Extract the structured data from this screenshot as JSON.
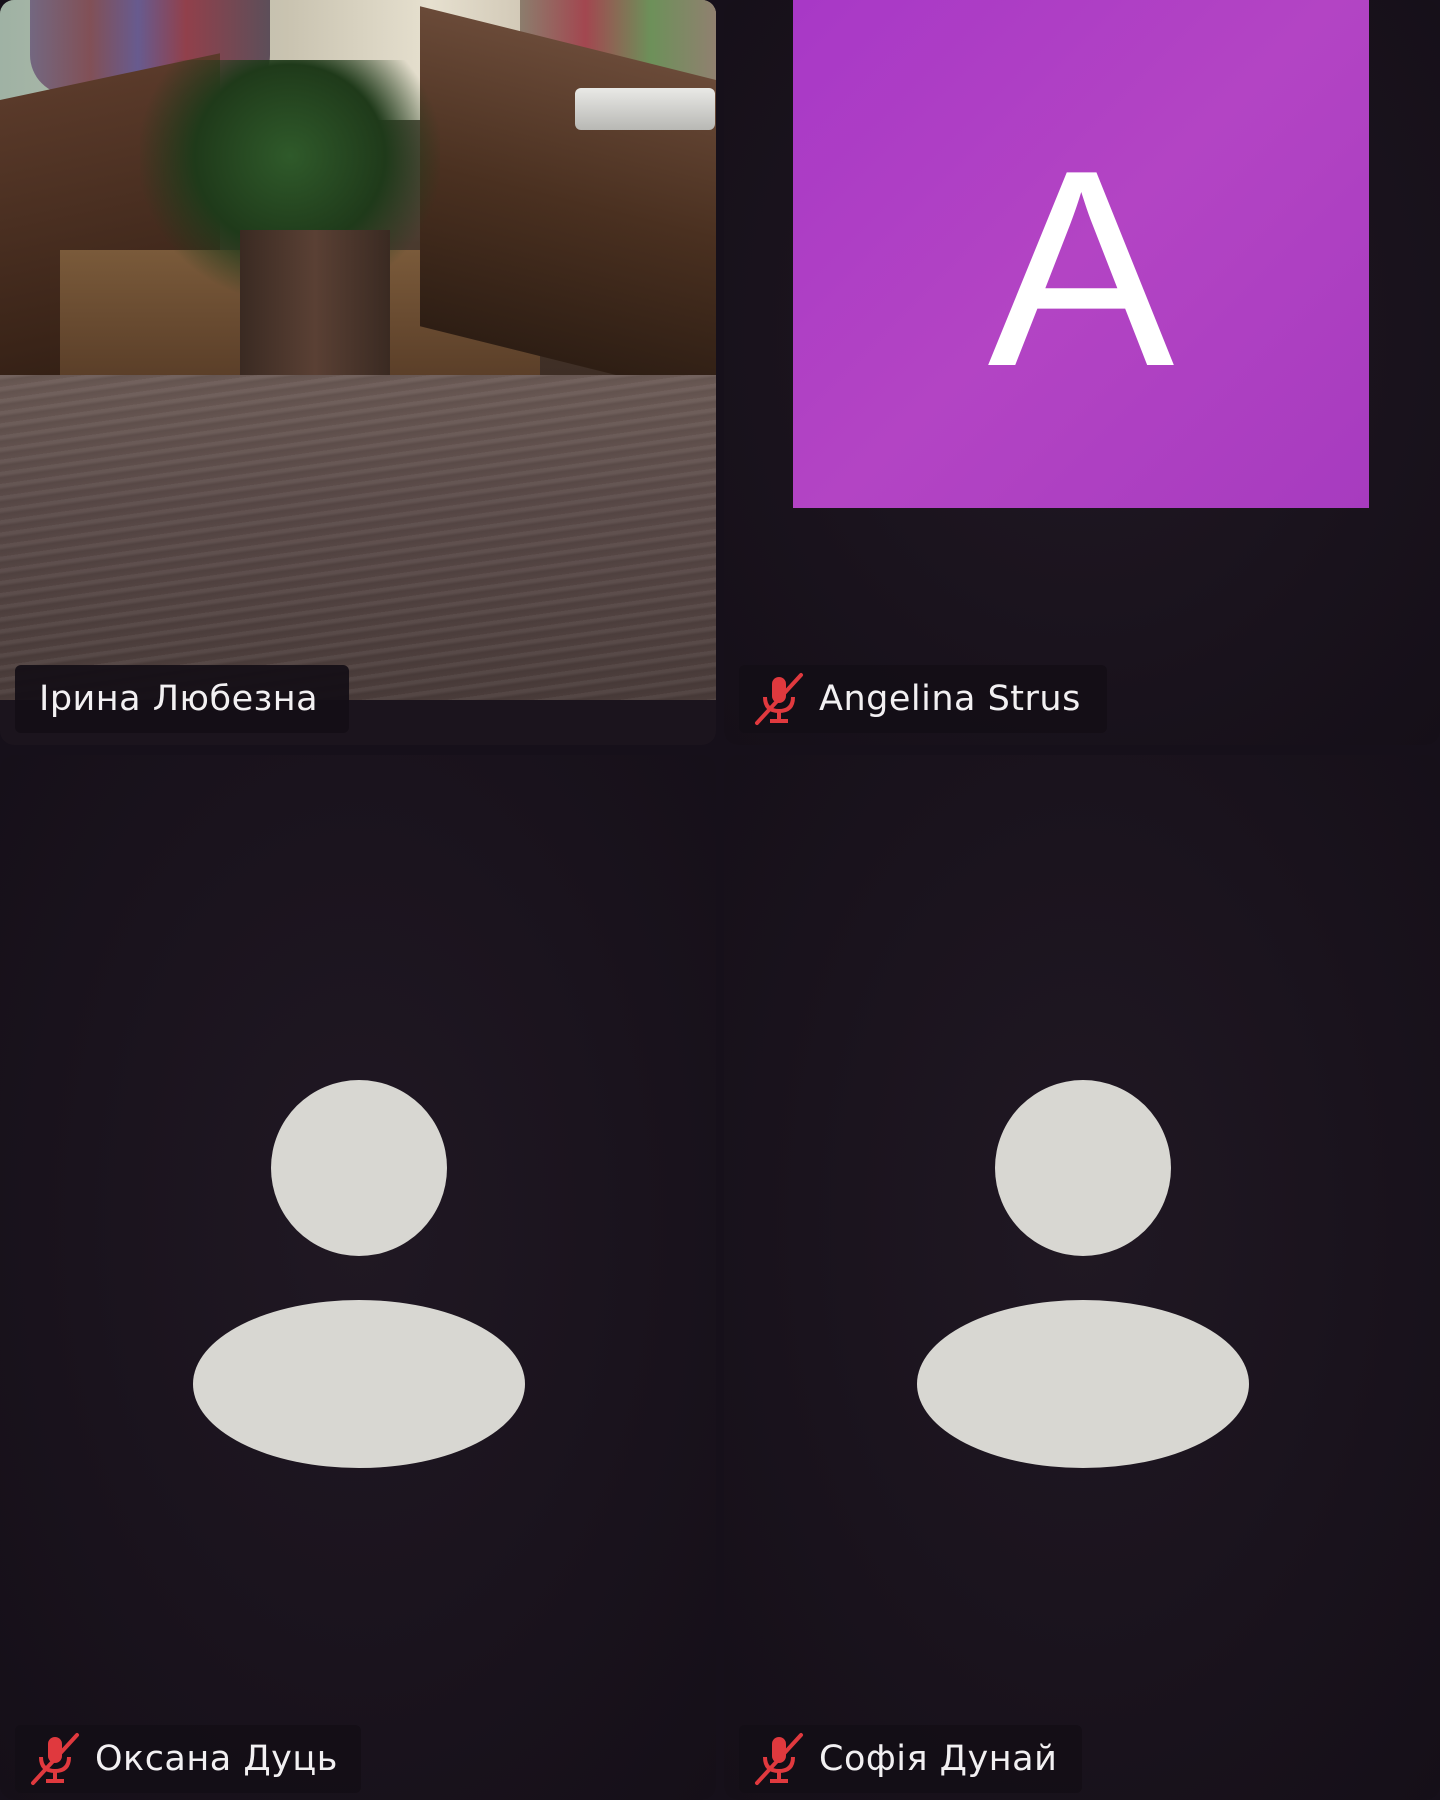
{
  "participants": [
    {
      "name": "Ірина Любезна",
      "muted": false,
      "feed": "video"
    },
    {
      "name": "Angelina Strus",
      "muted": true,
      "feed": "avatar-letter",
      "avatar_letter": "A",
      "avatar_color": "#a838c6"
    },
    {
      "name": "Оксана Дуць",
      "muted": true,
      "feed": "placeholder-person"
    },
    {
      "name": "Софія Дунай",
      "muted": true,
      "feed": "placeholder-person"
    }
  ],
  "icons": {
    "muted_mic": "mic-off-icon",
    "placeholder": "person-silhouette-icon"
  },
  "colors": {
    "background": "#16101a",
    "tile": "#1a131d",
    "muted_icon": "#e0393e",
    "avatar": "#a838c6",
    "silhouette": "#d8d7d2"
  }
}
